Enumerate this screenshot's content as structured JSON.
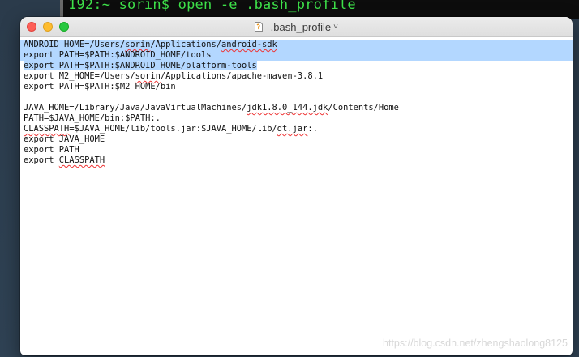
{
  "terminal": {
    "prompt": "192:~ sorin$ open -e .bash_profile"
  },
  "window": {
    "title": " .bash_profile",
    "title_chevron": "˅"
  },
  "editor": {
    "lines": [
      {
        "parts": [
          {
            "t": "ANDROID_HOME=/Users/"
          },
          {
            "t": "sorin",
            "sq": true
          },
          {
            "t": "/Applications/"
          },
          {
            "t": "android-sdk",
            "sq": true
          }
        ],
        "selected": "full"
      },
      {
        "parts": [
          {
            "t": "export PATH=$PATH:$ANDROID_HOME/tools"
          }
        ],
        "selected": "full"
      },
      {
        "parts": [
          {
            "t": "export PATH=$PATH:$ANDROID_HOME/platform-tools"
          }
        ],
        "selected": "partial"
      },
      {
        "parts": [
          {
            "t": "export M2_HOME=/Users/"
          },
          {
            "t": "sorin",
            "sq": true
          },
          {
            "t": "/Applications/apache-maven-3.8.1"
          }
        ]
      },
      {
        "parts": [
          {
            "t": "export PATH=$PATH:$M2_HOME/bin"
          }
        ]
      },
      {
        "parts": [
          {
            "t": ""
          }
        ]
      },
      {
        "parts": [
          {
            "t": "JAVA_HOME=/Library/Java/JavaVirtualMachines/"
          },
          {
            "t": "jdk1.8.0_144.jdk",
            "sq": true
          },
          {
            "t": "/Contents/Home"
          }
        ]
      },
      {
        "parts": [
          {
            "t": "PATH=$JAVA_HOME/bin:$PATH:."
          }
        ]
      },
      {
        "parts": [
          {
            "t": "CLASSPATH",
            "sq": true
          },
          {
            "t": "=$JAVA_HOME/lib/tools.jar:$JAVA_HOME/lib/"
          },
          {
            "t": "dt.jar",
            "sq": true
          },
          {
            "t": ":."
          }
        ]
      },
      {
        "parts": [
          {
            "t": "export JAVA_HOME"
          }
        ]
      },
      {
        "parts": [
          {
            "t": "export PATH"
          }
        ]
      },
      {
        "parts": [
          {
            "t": "export "
          },
          {
            "t": "CLASSPATH",
            "sq": true
          }
        ]
      }
    ]
  },
  "watermark": "https://blog.csdn.net/zhengshaolong8125",
  "colors": {
    "selection": "#b3d7ff",
    "terminal_text": "#3ee24a",
    "close": "#fd5f57",
    "minimize": "#febc2e",
    "maximize": "#28c840"
  }
}
